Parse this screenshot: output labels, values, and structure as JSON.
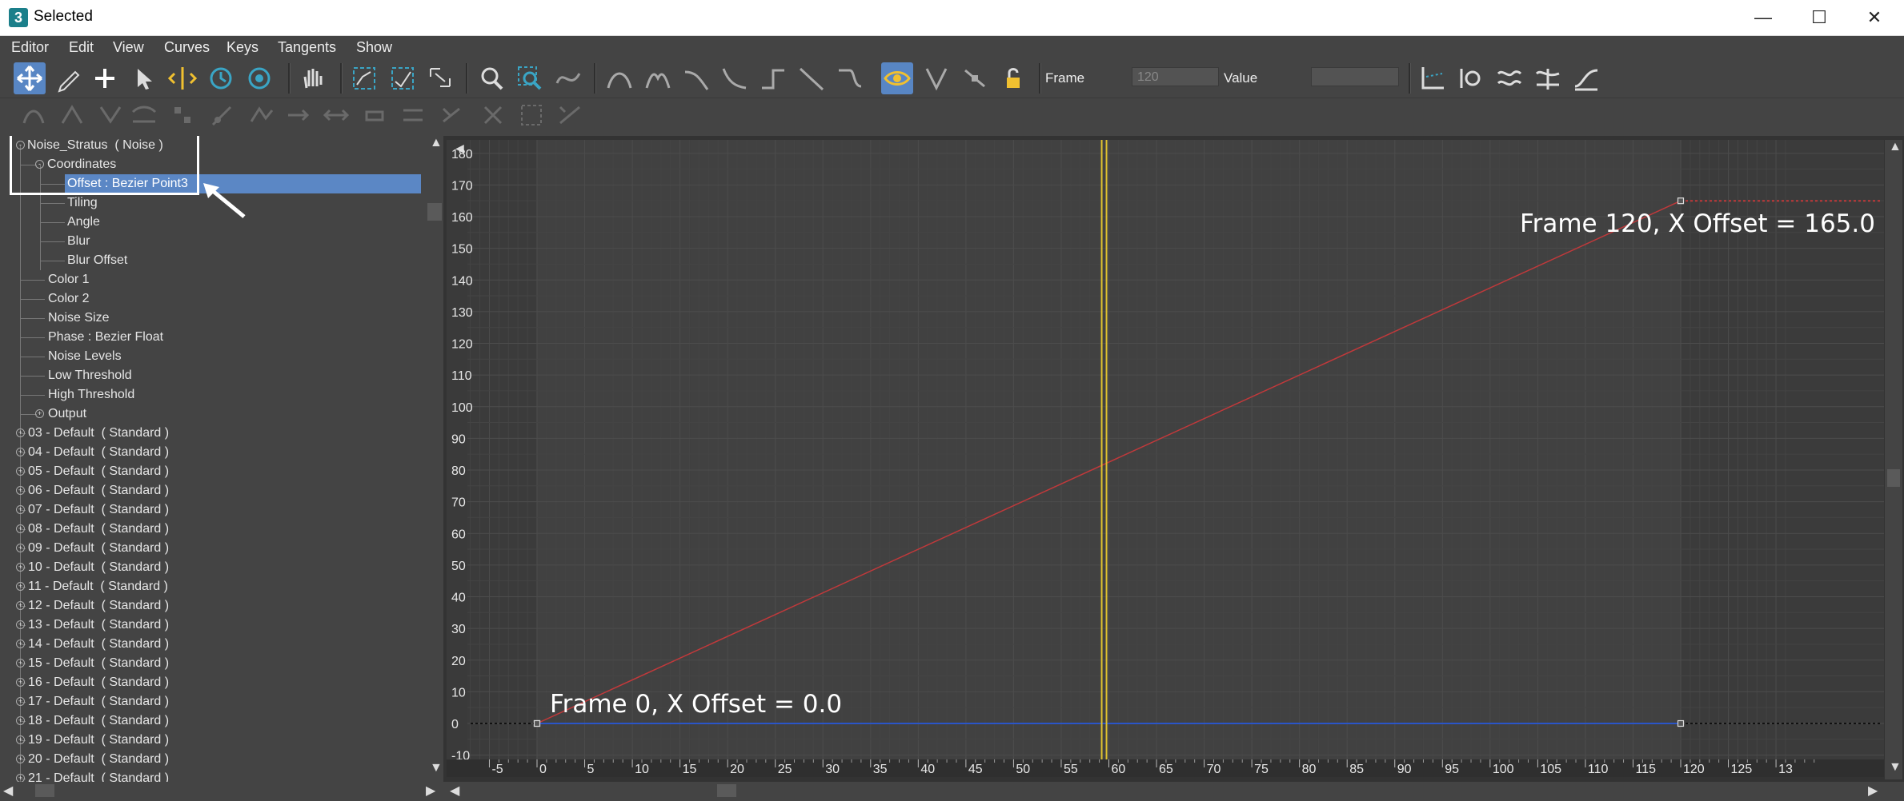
{
  "window": {
    "title": "Selected",
    "app_icon_label": "3",
    "controls": {
      "minimize": "—",
      "maximize": "☐",
      "close": "✕"
    }
  },
  "menu": [
    "Editor",
    "Edit",
    "View",
    "Curves",
    "Keys",
    "Tangents",
    "Show"
  ],
  "toolbar": {
    "frame_label": "Frame",
    "frame_value": "120",
    "value_label": "Value",
    "value_value": ""
  },
  "tree": {
    "root": "Noise_Stratus  ( Noise )",
    "coordinates": "Coordinates",
    "coord_children": [
      "Offset : Bezier Point3",
      "Tiling",
      "Angle",
      "Blur",
      "Blur Offset"
    ],
    "noise_children": [
      "Color 1",
      "Color 2",
      "Noise Size",
      "Phase : Bezier Float",
      "Noise Levels",
      "Low Threshold",
      "High Threshold",
      "Output"
    ],
    "materials": [
      "03 - Default  ( Standard )",
      "04 - Default  ( Standard )",
      "05 - Default  ( Standard )",
      "06 - Default  ( Standard )",
      "07 - Default  ( Standard )",
      "08 - Default  ( Standard )",
      "09 - Default  ( Standard )",
      "10 - Default  ( Standard )",
      "11 - Default  ( Standard )",
      "12 - Default  ( Standard )",
      "13 - Default  ( Standard )",
      "14 - Default  ( Standard )",
      "15 - Default  ( Standard )",
      "16 - Default  ( Standard )",
      "17 - Default  ( Standard )",
      "18 - Default  ( Standard )",
      "19 - Default  ( Standard )",
      "20 - Default  ( Standard )",
      "21 - Default  ( Standard )"
    ]
  },
  "graph": {
    "y_ticks": [
      "180",
      "170",
      "160",
      "150",
      "140",
      "130",
      "120",
      "110",
      "100",
      "90",
      "80",
      "70",
      "60",
      "50",
      "40",
      "30",
      "20",
      "10",
      "0",
      "-10"
    ],
    "x_ticks": [
      "-5",
      "0",
      "5",
      "10",
      "15",
      "20",
      "25",
      "30",
      "35",
      "40",
      "45",
      "50",
      "55",
      "60",
      "65",
      "70",
      "75",
      "80",
      "85",
      "90",
      "95",
      "100",
      "105",
      "110",
      "115",
      "120",
      "125",
      "13"
    ],
    "current_frame": 59.5,
    "range_start": 0,
    "range_end": 120,
    "annotation_start": "Frame 0, X Offset = 0.0",
    "annotation_end": "Frame 120, X Offset = 165.0",
    "colors": {
      "x_curve": "#c0393b",
      "y_curve": "#2a55c8",
      "time_slider": "#e0c230",
      "selection": "#5b87c5"
    }
  },
  "chart_data": {
    "type": "line",
    "xlabel": "",
    "ylabel": "",
    "xlim": [
      -9,
      131
    ],
    "ylim": [
      -10,
      181
    ],
    "series": [
      {
        "x": [
          0,
          120
        ],
        "y": [
          0,
          165
        ]
      },
      {
        "x": [
          0,
          120
        ],
        "y": [
          0,
          0
        ]
      }
    ]
  }
}
